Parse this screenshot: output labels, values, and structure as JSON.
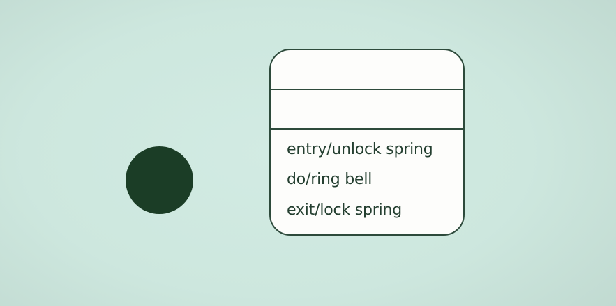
{
  "diagram": {
    "initial_node": {
      "shape": "filled-circle",
      "color": "#1b3d26"
    },
    "state": {
      "name": "",
      "internal_activities": [
        "entry/unlock spring",
        "do/ring bell",
        "exit/lock spring"
      ]
    }
  },
  "colors": {
    "background": "#cde7de",
    "box_fill": "#fdfdfb",
    "stroke": "#2d4a3b",
    "text": "#243f30"
  }
}
